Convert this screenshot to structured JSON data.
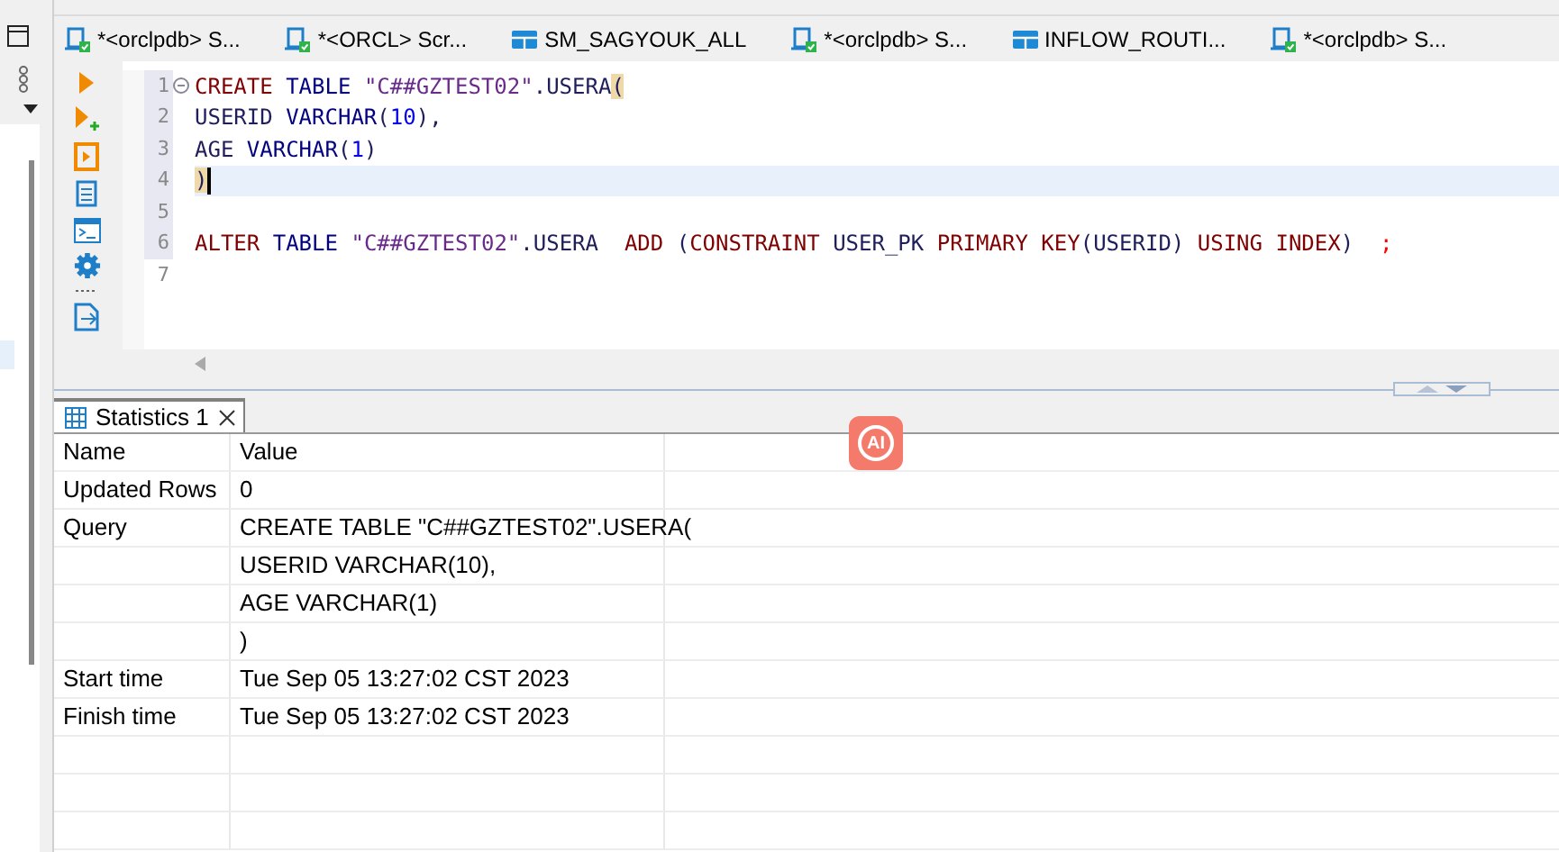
{
  "editor_tabs": [
    {
      "kind": "script",
      "label": "*<orclpdb> S...",
      "selected": false
    },
    {
      "kind": "script",
      "label": "*<ORCL> Scr...",
      "selected": false
    },
    {
      "kind": "table",
      "label": "SM_SAGYOUK_ALL",
      "selected": false
    },
    {
      "kind": "script",
      "label": "*<orclpdb> S...",
      "selected": false
    },
    {
      "kind": "table",
      "label": "INFLOW_ROUTI...",
      "selected": false
    },
    {
      "kind": "script",
      "label": "*<orclpdb> S...",
      "selected": false
    }
  ],
  "code_lines": [
    {
      "number": "1",
      "marked": true,
      "current": false,
      "fold_marker": true,
      "tokens": [
        {
          "kind": "keyword",
          "text": "CREATE "
        },
        {
          "kind": "type",
          "text": "TABLE "
        },
        {
          "kind": "string",
          "text": "\"C##GZTEST02\""
        },
        {
          "kind": "plain",
          "text": ".USERA"
        },
        {
          "kind": "bracket",
          "text": "("
        }
      ]
    },
    {
      "number": "2",
      "marked": true,
      "current": false,
      "fold_marker": false,
      "tokens": [
        {
          "kind": "plain",
          "text": "USERID "
        },
        {
          "kind": "type",
          "text": "VARCHAR"
        },
        {
          "kind": "plain",
          "text": "("
        },
        {
          "kind": "number",
          "text": "10"
        },
        {
          "kind": "plain",
          "text": "),"
        }
      ]
    },
    {
      "number": "3",
      "marked": true,
      "current": false,
      "fold_marker": false,
      "tokens": [
        {
          "kind": "plain",
          "text": "AGE "
        },
        {
          "kind": "type",
          "text": "VARCHAR"
        },
        {
          "kind": "plain",
          "text": "("
        },
        {
          "kind": "number",
          "text": "1"
        },
        {
          "kind": "plain",
          "text": ")"
        }
      ]
    },
    {
      "number": "4",
      "marked": true,
      "current": true,
      "fold_marker": false,
      "tokens": [
        {
          "kind": "bracket",
          "text": ")"
        }
      ]
    },
    {
      "number": "5",
      "marked": true,
      "current": false,
      "fold_marker": false
    },
    {
      "number": "6",
      "marked": true,
      "current": false,
      "fold_marker": false,
      "tokens": [
        {
          "kind": "keyword",
          "text": "ALTER "
        },
        {
          "kind": "type",
          "text": "TABLE "
        },
        {
          "kind": "string",
          "text": "\"C##GZTEST02\""
        },
        {
          "kind": "plain",
          "text": ".USERA  "
        },
        {
          "kind": "keyword",
          "text": "ADD "
        },
        {
          "kind": "plain",
          "text": "("
        },
        {
          "kind": "keyword",
          "text": "CONSTRAINT "
        },
        {
          "kind": "plain",
          "text": "USER_PK "
        },
        {
          "kind": "keyword",
          "text": "PRIMARY KEY"
        },
        {
          "kind": "plain",
          "text": "(USERID) "
        },
        {
          "kind": "keyword",
          "text": "USING INDEX"
        },
        {
          "kind": "plain",
          "text": ")  "
        },
        {
          "kind": "semicolon",
          "text": ";"
        }
      ]
    },
    {
      "number": "7",
      "marked": false,
      "current": false,
      "fold_marker": false
    }
  ],
  "results_tab": {
    "label": "Statistics 1",
    "selected": true
  },
  "ai_badge": "AI",
  "table": {
    "columns": [
      "Name",
      "Value"
    ],
    "rows": [
      [
        "Updated Rows",
        "0"
      ],
      [
        "Query",
        "CREATE TABLE \"C##GZTEST02\".USERA("
      ],
      [
        "",
        "USERID VARCHAR(10),"
      ],
      [
        "",
        "AGE VARCHAR(1)"
      ],
      [
        "",
        ")"
      ],
      [
        "Start time",
        "Tue Sep 05 13:27:02 CST 2023"
      ],
      [
        "Finish time",
        "Tue Sep 05 13:27:02 CST 2023"
      ]
    ]
  }
}
